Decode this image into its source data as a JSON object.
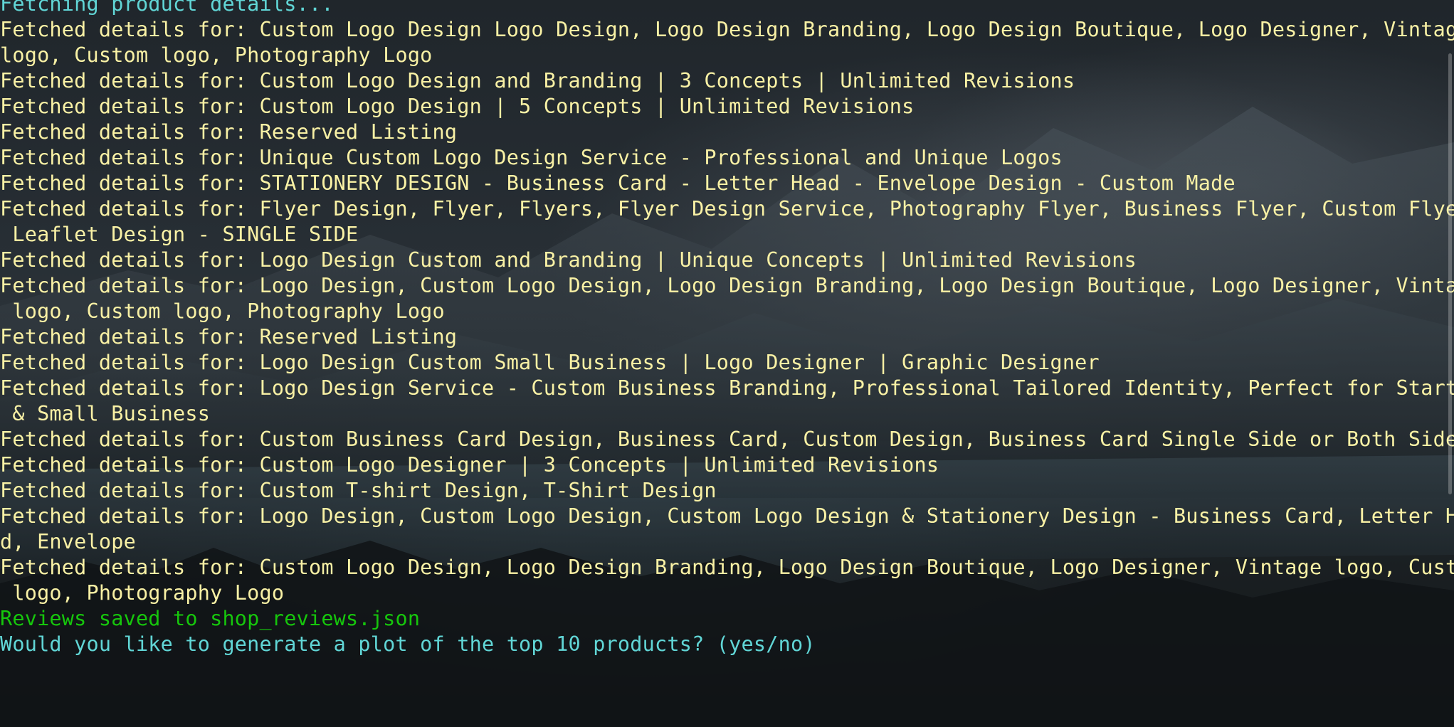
{
  "terminal": {
    "lines": [
      {
        "text": "Fetching product details...",
        "color": "cyan"
      },
      {
        "text": "Fetched details for: Custom Logo Design Logo Design, Logo Design Branding, Logo Design Boutique, Logo Designer, Vintage",
        "color": "yellow"
      },
      {
        "text": "logo, Custom logo, Photography Logo",
        "color": "yellow"
      },
      {
        "text": "Fetched details for: Custom Logo Design and Branding | 3 Concepts | Unlimited Revisions",
        "color": "yellow"
      },
      {
        "text": "Fetched details for: Custom Logo Design | 5 Concepts | Unlimited Revisions",
        "color": "yellow"
      },
      {
        "text": "Fetched details for: Reserved Listing",
        "color": "yellow"
      },
      {
        "text": "Fetched details for: Unique Custom Logo Design Service - Professional and Unique Logos",
        "color": "yellow"
      },
      {
        "text": "Fetched details for: STATIONERY DESIGN - Business Card - Letter Head - Envelope Design - Custom Made",
        "color": "yellow"
      },
      {
        "text": "Fetched details for: Flyer Design, Flyer, Flyers, Flyer Design Service, Photography Flyer, Business Flyer, Custom Flyer,",
        "color": "yellow"
      },
      {
        "text": " Leaflet Design - SINGLE SIDE",
        "color": "yellow"
      },
      {
        "text": "Fetched details for: Logo Design Custom and Branding | Unique Concepts | Unlimited Revisions",
        "color": "yellow"
      },
      {
        "text": "Fetched details for: Logo Design, Custom Logo Design, Logo Design Branding, Logo Design Boutique, Logo Designer, Vintage",
        "color": "yellow"
      },
      {
        "text": " logo, Custom logo, Photography Logo",
        "color": "yellow"
      },
      {
        "text": "Fetched details for: Reserved Listing",
        "color": "yellow"
      },
      {
        "text": "Fetched details for: Logo Design Custom Small Business | Logo Designer | Graphic Designer",
        "color": "yellow"
      },
      {
        "text": "Fetched details for: Logo Design Service - Custom Business Branding, Professional Tailored Identity, Perfect for Startup",
        "color": "yellow"
      },
      {
        "text": " & Small Business",
        "color": "yellow"
      },
      {
        "text": "Fetched details for: Custom Business Card Design, Business Card, Custom Design, Business Card Single Side or Both Side",
        "color": "yellow"
      },
      {
        "text": "Fetched details for: Custom Logo Designer | 3 Concepts | Unlimited Revisions",
        "color": "yellow"
      },
      {
        "text": "Fetched details for: Custom T-shirt Design, T-Shirt Design",
        "color": "yellow"
      },
      {
        "text": "Fetched details for: Logo Design, Custom Logo Design, Custom Logo Design & Stationery Design - Business Card, Letter Hea",
        "color": "yellow"
      },
      {
        "text": "d, Envelope",
        "color": "yellow"
      },
      {
        "text": "Fetched details for: Custom Logo Design, Logo Design Branding, Logo Design Boutique, Logo Designer, Vintage logo, Custom",
        "color": "yellow"
      },
      {
        "text": " logo, Photography Logo",
        "color": "yellow"
      },
      {
        "text": "Reviews saved to shop_reviews.json",
        "color": "green"
      },
      {
        "text": "Would you like to generate a plot of the top 10 products? (yes/no)",
        "color": "cyan"
      }
    ]
  },
  "colors": {
    "cyan": "#61d6d6",
    "yellow": "#f9f1a5",
    "green": "#16c60c",
    "background": "#1b2126"
  }
}
